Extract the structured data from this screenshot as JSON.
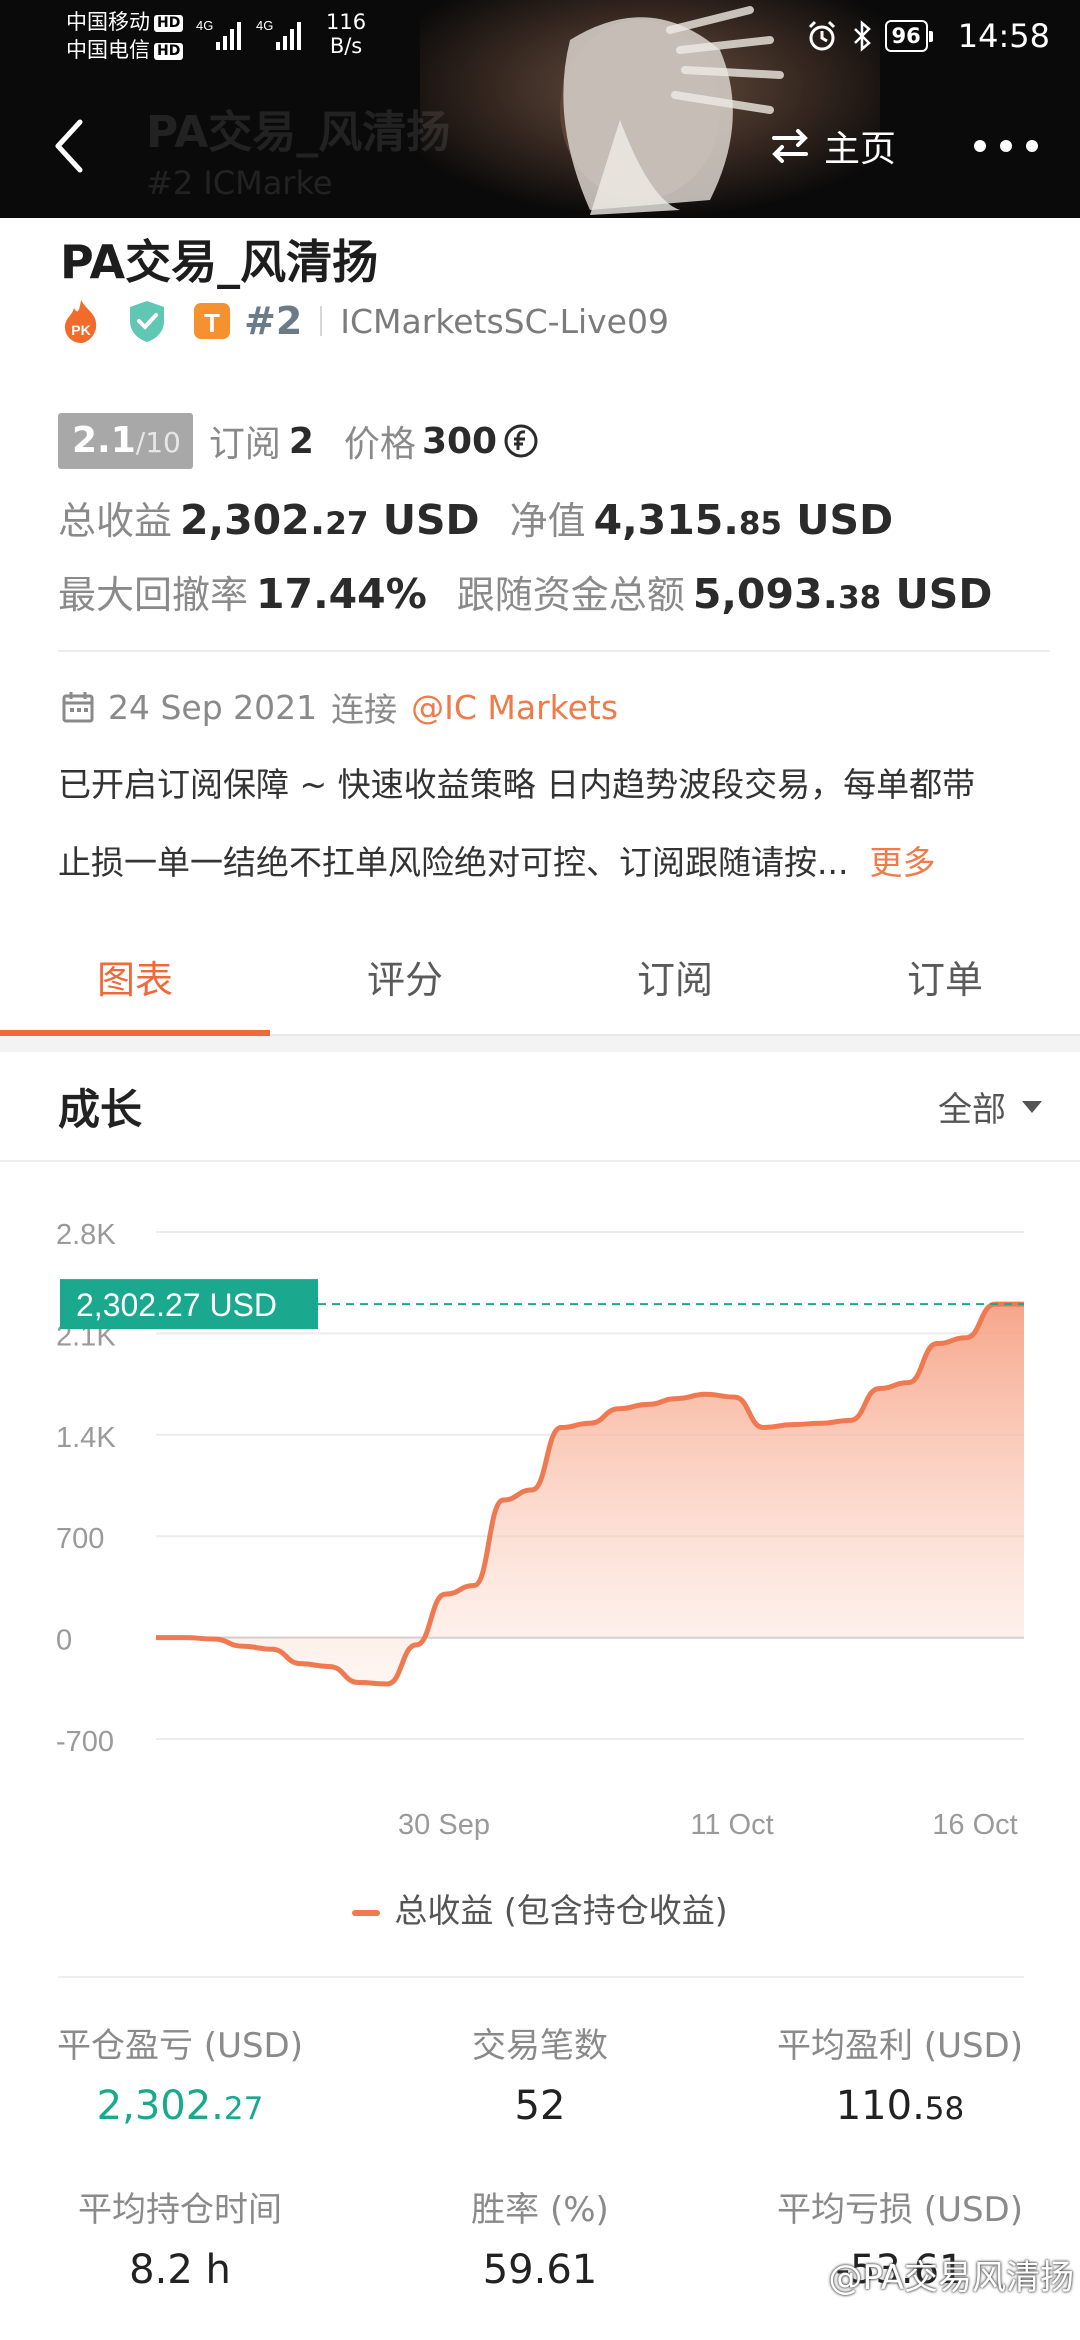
{
  "status_bar": {
    "carrier1": "中国移动",
    "carrier2": "中国电信",
    "hd": "HD",
    "net1": "4G",
    "net2": "4G",
    "speed_value": "116",
    "speed_unit": "B/s",
    "battery": "96",
    "time": "14:58"
  },
  "header": {
    "ghost_title": "PA交易_风清扬",
    "ghost_sub": "#2  ICMarke",
    "home_label": "主页"
  },
  "profile": {
    "title": "PA交易_风清扬",
    "badge_pk": "PK",
    "badge_t": "T",
    "rank": "#2",
    "server": "ICMarketsSC-Live09"
  },
  "rating": {
    "score": "2.1",
    "score_max": "/10",
    "subscribe_label": "订阅",
    "subscribe_count": "2",
    "price_label": "价格",
    "price_value": "300"
  },
  "stats_top": {
    "total_profit_label": "总收益",
    "total_profit_int": "2,302.",
    "total_profit_dec": "27",
    "total_profit_unit": "USD",
    "equity_label": "净值",
    "equity_int": "4,315.",
    "equity_dec": "85",
    "equity_unit": "USD",
    "max_dd_label": "最大回撤率",
    "max_dd_value": "17.44%",
    "follow_label": "跟随资金总额",
    "follow_int": "5,093.",
    "follow_dec": "38",
    "follow_unit": "USD"
  },
  "info": {
    "date": "24 Sep 2021",
    "connect_label": "连接",
    "broker": "@IC Markets",
    "desc_line1": "已开启订阅保障 ~ 快速收益策略 日内趋势波段交易，每单都带",
    "desc_line2": "止损一单一结绝不扛单风险绝对可控、订阅跟随请按...",
    "more_label": "更多"
  },
  "tabs": [
    "图表",
    "评分",
    "订阅",
    "订单"
  ],
  "growth": {
    "title": "成长",
    "range_label": "全部"
  },
  "chart_data": {
    "type": "area",
    "y_ticks": [
      "2.8K",
      "2.1K",
      "1.4K",
      "700",
      "0",
      "-700"
    ],
    "ylim": [
      -700,
      2800
    ],
    "x_tick_labels": [
      "30 Sep",
      "11 Oct",
      "16 Oct"
    ],
    "series": [
      {
        "name": "总收益 (包含持仓收益)",
        "values": [
          0,
          0,
          -10,
          -60,
          -80,
          -180,
          -200,
          -310,
          -320,
          -50,
          300,
          360,
          950,
          1020,
          1450,
          1480,
          1580,
          1610,
          1650,
          1680,
          1660,
          1450,
          1470,
          1480,
          1500,
          1720,
          1760,
          2030,
          2070,
          2302.27,
          2302.27
        ]
      }
    ],
    "current_value_label": "2,302.27 USD",
    "current_value": 2302.27,
    "line_color": "#ef7a52",
    "reference_line_color": "#1aa88f"
  },
  "legend_label": "总收益 (包含持仓收益)",
  "stats_grid": {
    "closed_pl_label": "平仓盈亏 (USD)",
    "closed_pl_int": "2,302.",
    "closed_pl_dec": "27",
    "trades_label": "交易笔数",
    "trades_value": "52",
    "avg_profit_label": "平均盈利 (USD)",
    "avg_profit_int": "110.",
    "avg_profit_dec": "58",
    "hold_time_label": "平均持仓时间",
    "hold_time_value": "8.2 h",
    "win_rate_label": "胜率 (%)",
    "win_rate_value": "59.61",
    "avg_loss_label": "平均亏损 (USD)",
    "avg_loss_value": "-53.61"
  },
  "watermark": "@PA交易风清扬",
  "colors": {
    "accent": "#ef6a3a",
    "green": "#19a98d",
    "header_bg": "#0a0a0a"
  }
}
